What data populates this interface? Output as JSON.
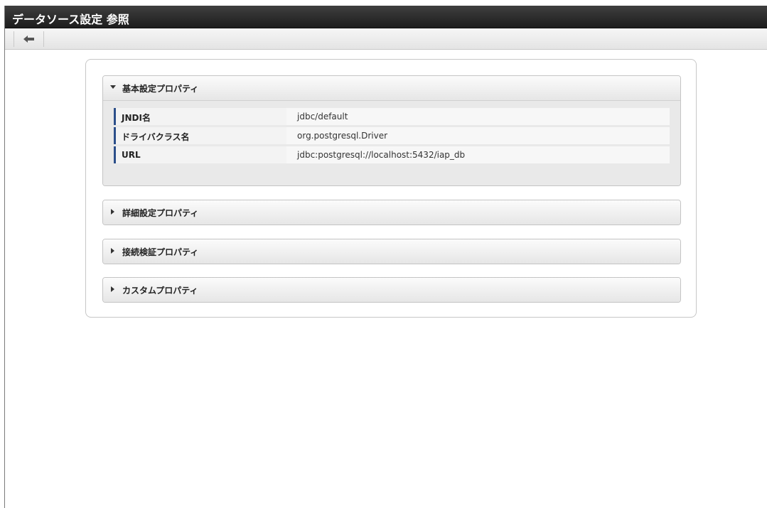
{
  "window": {
    "title": "データソース設定 参照"
  },
  "toolbar": {
    "back_icon": "arrow-left-icon"
  },
  "sections": [
    {
      "label": "基本設定プロパティ",
      "expanded": true,
      "properties": [
        {
          "key": "JNDI名",
          "value": "jdbc/default"
        },
        {
          "key": "ドライバクラス名",
          "value": "org.postgresql.Driver"
        },
        {
          "key": "URL",
          "value": "jdbc:postgresql://localhost:5432/iap_db"
        }
      ]
    },
    {
      "label": "詳細設定プロパティ",
      "expanded": false
    },
    {
      "label": "接続検証プロパティ",
      "expanded": false
    },
    {
      "label": "カスタムプロパティ",
      "expanded": false
    }
  ],
  "colors": {
    "titlebar": "#2a2a2a",
    "accent_bar": "#2c4f8a"
  }
}
